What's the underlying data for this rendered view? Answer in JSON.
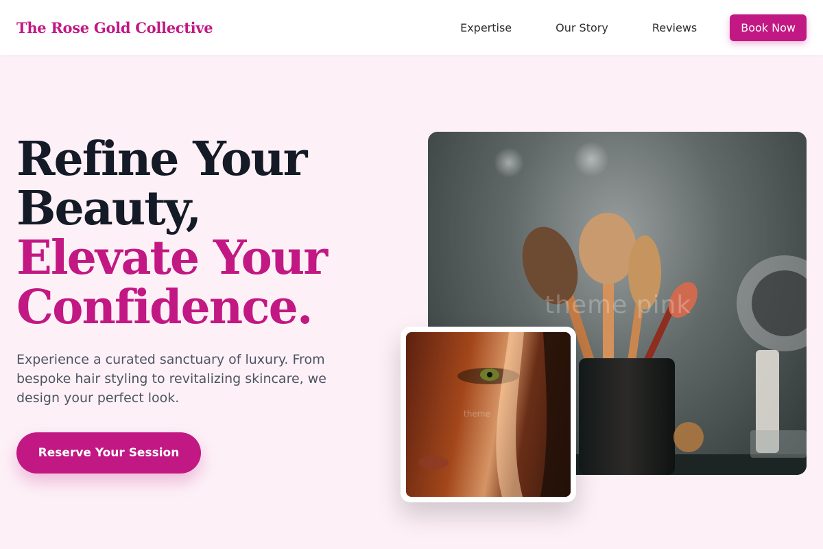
{
  "nav": {
    "brand": "The Rose Gold Collective",
    "links": [
      "Expertise",
      "Our Story",
      "Reviews"
    ],
    "cta": "Book Now"
  },
  "hero": {
    "headline_line1": "Refine Your",
    "headline_line2": "Beauty,",
    "headline_line3": "Elevate Your",
    "headline_line4": "Confidence.",
    "subtext": "Experience a curated sanctuary of luxury. From bespoke hair styling to revitalizing skincare, we design your perfect look.",
    "cta": "Reserve Your Session"
  },
  "images": {
    "main_watermark": "theme pink",
    "inset_watermark": "theme"
  },
  "colors": {
    "accent": "#c21883",
    "headline_dark": "#141a26",
    "background": "#fdf1f7"
  }
}
